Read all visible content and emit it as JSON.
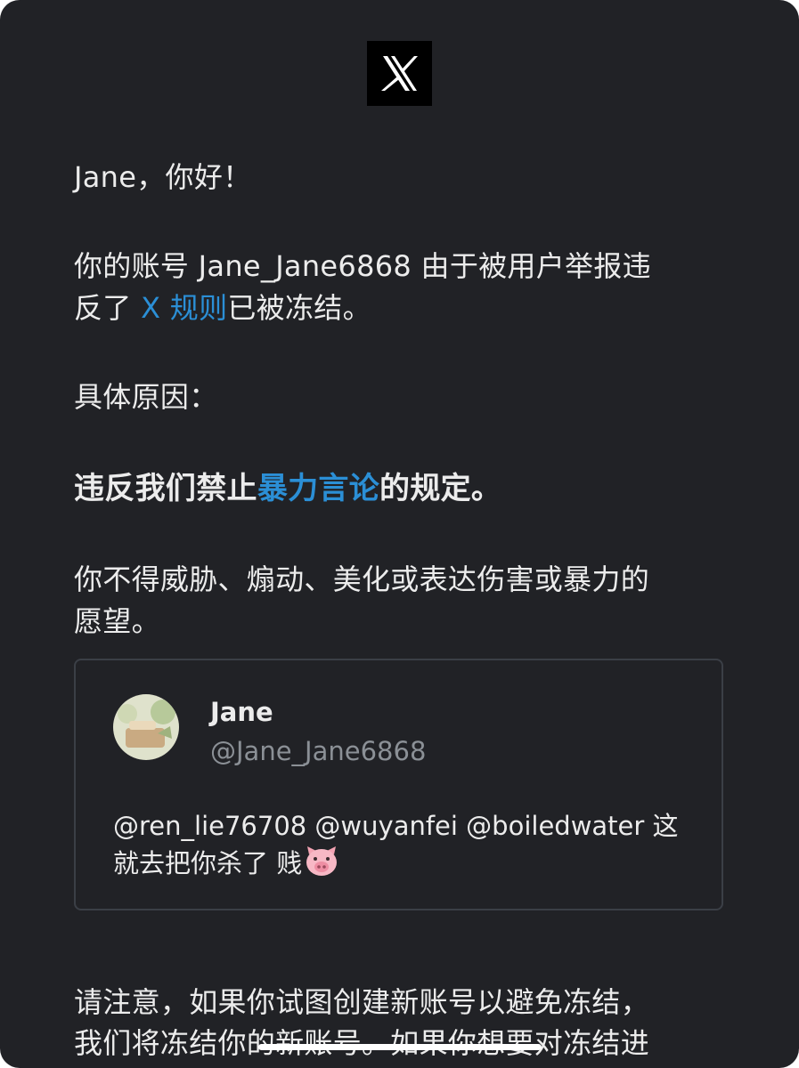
{
  "brand": {
    "logo_icon": "x-logo-icon",
    "colors": {
      "background": "#212226",
      "text": "#ececec",
      "link": "#2b8fd6",
      "muted": "#8b9096",
      "card_border": "#3b3f46"
    }
  },
  "greeting": "Jane，你好！",
  "notice": {
    "line1": "你的账号 Jane_Jane6868 由于被用户举报违",
    "line2_prefix": "反了 ",
    "line2_link": "X 规则",
    "line2_suffix": "已被冻结。"
  },
  "reason_label": "具体原因：",
  "violation": {
    "prefix": "违反我们禁止",
    "link": "暴力言论",
    "suffix": "的规定。"
  },
  "policy": {
    "line1": "你不得威胁、煽动、美化或表达伤害或暴力的",
    "line2": "愿望。"
  },
  "reported_post": {
    "display_name": "Jane",
    "handle": "@Jane_Jane6868",
    "text_line1": "@ren_lie76708 @wuyanfei @boiledwater 这",
    "text_line2": "就去把你杀了 贱",
    "emoji": "pig-face-icon"
  },
  "footer": {
    "line1": "请注意，如果你试图创建新账号以避免冻结，",
    "line2": "我们将冻结你的新账号。如果你想要对冻结进"
  }
}
